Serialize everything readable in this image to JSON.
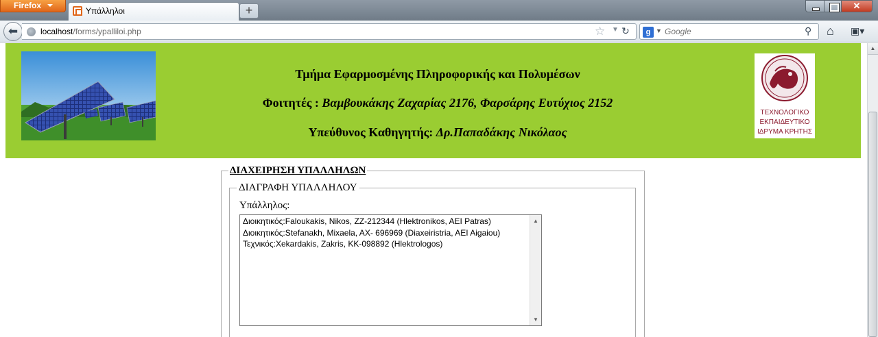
{
  "browser": {
    "menu_button": "Firefox",
    "tab_title": "Υπάλληλοι",
    "new_tab": "+",
    "close_symbol": "✕",
    "url_host": "localhost",
    "url_path": "/forms/ypalliloi.php",
    "search_placeholder": "Google",
    "search_engine_letter": "g"
  },
  "banner": {
    "department": "Τμήμα Εφαρμοσμένης Πληροφορικής και Πολυμέσων",
    "students_label": "Φοιτητές : ",
    "students": "Βαμβουκάκης Ζαχαρίας 2176, Φαρσάρης Ευτύχιος 2152",
    "supervisor_label": "Υπεύθυνος Καθηγητής: ",
    "supervisor": "Δρ.Παπαδάκης Νικόλαος",
    "logo_lines": [
      "ΤΕΧΝΟΛΟΓΙΚΟ",
      "ΕΚΠΑΙΔΕΥΤΙΚΟ",
      "ΙΔΡΥΜΑ ΚΡΗΤΗΣ"
    ],
    "colors": {
      "background": "#9acd32",
      "logo_red": "#8b1a2e"
    }
  },
  "form": {
    "outer_legend": "ΔΙΑΧΕΙΡΗΣΗ ΥΠΑΛΛΗΛΩΝ",
    "inner_legend": "ΔΙΑΓΡΑΦΗ ΥΠΑΛΛΗΛΟΥ",
    "field_label": "Υπάλληλος:",
    "employees": [
      "Διοικητικός:Faloukakis, Nikos, ZZ-212344 (Hlektronikos, AEI Patras)",
      "Διοικητικός:Stefanakh, Mixaela, AX- 696969 (Diaxeiristria, AEI Aigaiou)",
      "Τεχνικός:Xekardakis, Zakris, KK-098892 (Hlektrologos)"
    ]
  },
  "icons": [
    "back-arrow-icon",
    "globe-icon",
    "bookmark-star-icon",
    "reload-icon",
    "search-icon",
    "home-icon",
    "bookmarks-menu-icon"
  ]
}
